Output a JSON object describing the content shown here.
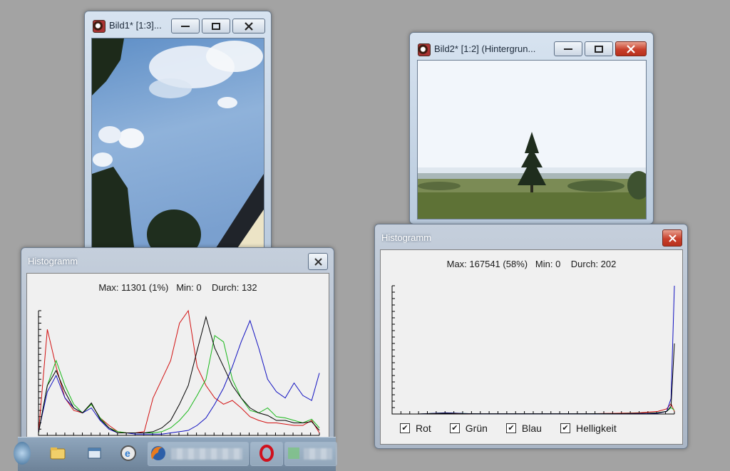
{
  "window1": {
    "title": "Bild1* [1:3]..."
  },
  "window2": {
    "title": "Bild2* [1:2] (Hintergrun..."
  },
  "hist1": {
    "title": "Histogramm",
    "stats": "Max: 11301 (1%)   Min: 0    Durch: 132"
  },
  "hist2": {
    "title": "Histogramm",
    "stats": "Max: 167541 (58%)   Min: 0    Durch: 202",
    "checkboxes": [
      {
        "label": "Rot",
        "checked": true,
        "mark": "✔"
      },
      {
        "label": "Grün",
        "checked": true,
        "mark": "✔"
      },
      {
        "label": "Blau",
        "checked": true,
        "mark": "✔"
      },
      {
        "label": "Helligkeit",
        "checked": true,
        "mark": "✔"
      }
    ]
  },
  "colors": {
    "red": "#d21010",
    "green": "#18b818",
    "blue": "#1010c0",
    "black": "#000000"
  },
  "chart_data": [
    {
      "type": "line",
      "x": [
        0,
        8,
        16,
        24,
        32,
        40,
        48,
        56,
        64,
        72,
        80,
        88,
        96,
        104,
        112,
        120,
        128,
        136,
        144,
        152,
        160,
        168,
        176,
        184,
        192,
        200,
        208,
        216,
        224,
        232,
        240,
        248,
        255
      ],
      "xlim": [
        0,
        255
      ],
      "series": [
        {
          "name": "Rot",
          "values": [
            2,
            85,
            55,
            30,
            20,
            18,
            25,
            14,
            8,
            3,
            2,
            2,
            3,
            30,
            45,
            60,
            90,
            100,
            55,
            40,
            30,
            25,
            28,
            22,
            15,
            12,
            10,
            10,
            9,
            8,
            8,
            12,
            2
          ]
        },
        {
          "name": "Grün",
          "values": [
            2,
            40,
            60,
            40,
            25,
            18,
            25,
            14,
            6,
            3,
            2,
            2,
            2,
            2,
            3,
            6,
            12,
            20,
            32,
            45,
            80,
            75,
            45,
            30,
            20,
            18,
            22,
            15,
            14,
            12,
            10,
            13,
            6
          ]
        },
        {
          "name": "Blau",
          "values": [
            3,
            35,
            48,
            30,
            22,
            18,
            22,
            12,
            5,
            2,
            2,
            1,
            1,
            1,
            1,
            2,
            3,
            4,
            8,
            14,
            25,
            38,
            55,
            75,
            92,
            70,
            45,
            35,
            30,
            42,
            32,
            28,
            50
          ]
        },
        {
          "name": "Helligkeit",
          "values": [
            2,
            40,
            52,
            35,
            22,
            18,
            26,
            13,
            6,
            2,
            2,
            2,
            2,
            3,
            6,
            12,
            25,
            40,
            68,
            95,
            70,
            55,
            40,
            30,
            22,
            18,
            16,
            12,
            12,
            10,
            10,
            11,
            4
          ]
        }
      ]
    },
    {
      "type": "line",
      "x": [
        0,
        8,
        16,
        24,
        32,
        40,
        48,
        56,
        64,
        72,
        80,
        88,
        96,
        104,
        112,
        120,
        128,
        136,
        144,
        152,
        160,
        168,
        176,
        184,
        192,
        200,
        208,
        216,
        224,
        232,
        240,
        248,
        252,
        255
      ],
      "xlim": [
        0,
        255
      ],
      "series": [
        {
          "name": "Rot",
          "values": [
            0,
            0,
            0,
            0,
            0.3,
            0.5,
            0.6,
            0.5,
            0.3,
            0.2,
            0.1,
            0.1,
            0.1,
            0.1,
            0.1,
            0.1,
            0.1,
            0.1,
            0.1,
            0.1,
            0.1,
            0.2,
            0.2,
            0.3,
            0.4,
            0.5,
            0.6,
            0.8,
            1,
            1.5,
            2,
            4,
            8,
            2
          ]
        },
        {
          "name": "Grün",
          "values": [
            0,
            0,
            0,
            0,
            0.3,
            0.6,
            0.8,
            0.6,
            0.4,
            0.2,
            0.1,
            0.1,
            0.1,
            0.1,
            0.1,
            0.1,
            0.1,
            0.1,
            0.1,
            0.1,
            0.1,
            0.1,
            0.1,
            0.2,
            0.2,
            0.3,
            0.3,
            0.4,
            0.5,
            0.6,
            1,
            2,
            5,
            3
          ]
        },
        {
          "name": "Blau",
          "values": [
            0,
            0,
            0,
            0,
            0.3,
            0.6,
            0.9,
            0.7,
            0.4,
            0.2,
            0.1,
            0.1,
            0.1,
            0.1,
            0.1,
            0.1,
            0.1,
            0.1,
            0.1,
            0.1,
            0.1,
            0.1,
            0.1,
            0.1,
            0.2,
            0.2,
            0.2,
            0.3,
            0.3,
            0.4,
            0.6,
            2,
            12,
            100
          ]
        },
        {
          "name": "Helligkeit",
          "values": [
            0,
            0,
            0,
            0,
            0.2,
            0.4,
            0.6,
            0.5,
            0.3,
            0.2,
            0.1,
            0.1,
            0.1,
            0.1,
            0.1,
            0.1,
            0.1,
            0.1,
            0.1,
            0.1,
            0.1,
            0.1,
            0.1,
            0.2,
            0.2,
            0.3,
            0.3,
            0.4,
            0.5,
            0.6,
            0.9,
            2,
            6,
            55
          ]
        }
      ]
    }
  ]
}
